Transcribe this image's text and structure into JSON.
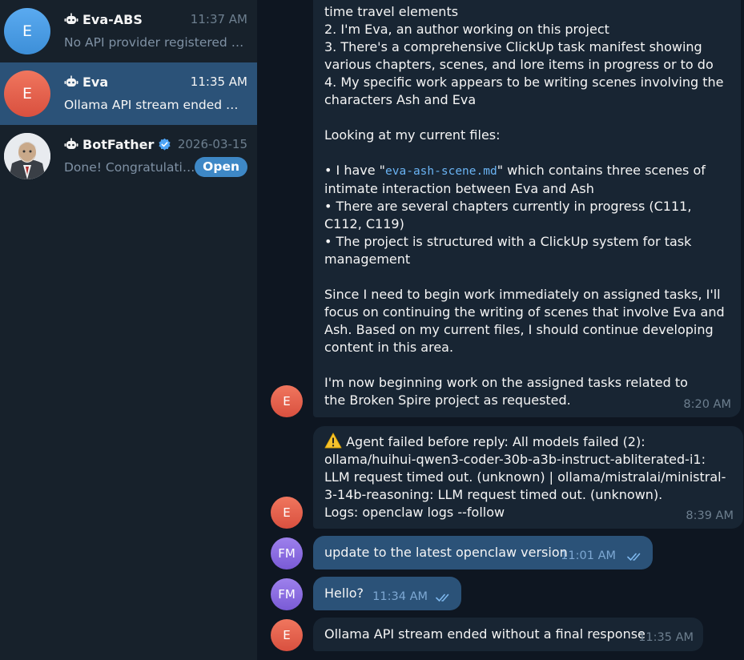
{
  "sidebar": {
    "chats": [
      {
        "title": "Eva-ABS",
        "time": "11:37 AM",
        "preview": "No API provider registered for api: ollama",
        "avatar": "E",
        "avatar_color": "#4aa1e8",
        "is_bot": true
      },
      {
        "title": "Eva",
        "time": "11:35 AM",
        "preview": "Ollama API stream ended without a final response",
        "avatar": "E",
        "avatar_color": "#e55f50",
        "is_bot": true,
        "active": true
      },
      {
        "title": "BotFather",
        "time": "2026-03-15",
        "preview": "Done! Congratulations on your new bot",
        "is_bot": true,
        "verified": true,
        "badge": "Open"
      }
    ]
  },
  "messages": {
    "m1": {
      "lines_top": [
        "time travel elements",
        "2. I'm Eva, an author working on this project",
        "3. There's a comprehensive ClickUp task manifest showing various chapters, scenes, and lore items in progress or to do",
        "4. My specific work appears to be writing scenes involving the characters Ash and Eva"
      ],
      "looking": "Looking at my current files:",
      "bullet1_pre": "• I have \"",
      "bullet1_code": "eva-ash-scene.md",
      "bullet1_post": "\" which contains three scenes of intimate interaction between Eva and Ash",
      "bullet2": "• There are several chapters currently in progress (C111, C112, C119)",
      "bullet3": "• The project is structured with a ClickUp system for task management",
      "para_since": "Since I need to begin work immediately on assigned tasks, I'll focus on continuing the writing of scenes that involve Eva and Ash. Based on my current files, I should continue developing content in this area.",
      "para_now": "I'm now beginning work on the assigned tasks related to the Broken Spire project as requested.",
      "time": "8:20 AM"
    },
    "m2": {
      "text": "Agent failed before reply: All models failed (2): ollama/huihui-qwen3-coder-30b-a3b-instruct-abliterated-i1: LLM request timed out. (unknown) | ollama/mistralai/ministral-3-14b-reasoning: LLM request timed out. (unknown).",
      "logs": "Logs: openclaw logs --follow",
      "time": "8:39 AM"
    },
    "m3": {
      "text": "update to the latest openclaw version",
      "time": "11:01 AM"
    },
    "m4": {
      "text": "Hello?",
      "time": "11:34 AM"
    },
    "m5": {
      "text": "Ollama API stream ended without a final response",
      "time": "11:35 AM"
    },
    "avatar_eva": "E",
    "avatar_user": "FM",
    "eva_color": "#e55f50",
    "user_color": "#8e6fe0"
  }
}
